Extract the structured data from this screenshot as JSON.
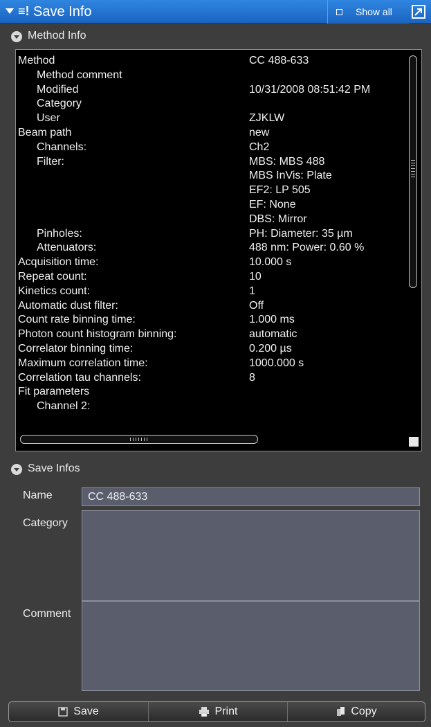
{
  "titlebar": {
    "title": "Save Info",
    "show_all_label": "Show all",
    "icons": [
      "collapse-arrow-icon",
      "list-icon",
      "checkbox-icon",
      "undock-icon"
    ]
  },
  "method_info": {
    "header": "Method Info",
    "rows": [
      {
        "key": "Method",
        "value": "CC 488-633",
        "indent": 0
      },
      {
        "key": "Method comment",
        "value": "",
        "indent": 1
      },
      {
        "key": "Modified",
        "value": "10/31/2008 08:51:42 PM",
        "indent": 1
      },
      {
        "key": "Category",
        "value": "",
        "indent": 1
      },
      {
        "key": "User",
        "value": "ZJKLW",
        "indent": 1
      },
      {
        "key": "Beam path",
        "value": "new",
        "indent": 0
      },
      {
        "key": "Channels:",
        "value": "Ch2",
        "indent": 1
      },
      {
        "key": "Filter:",
        "value": "MBS:  MBS 488",
        "indent": 1
      },
      {
        "key": "",
        "value": "MBS InVis:  Plate",
        "indent": 1
      },
      {
        "key": "",
        "value": "EF2:  LP 505",
        "indent": 1
      },
      {
        "key": "",
        "value": "EF:  None",
        "indent": 1
      },
      {
        "key": "",
        "value": "DBS:  Mirror",
        "indent": 1
      },
      {
        "key": "Pinholes:",
        "value": "PH:  Diameter: 35 µm",
        "indent": 1
      },
      {
        "key": "Attenuators:",
        "value": "488 nm:  Power: 0.60 %",
        "indent": 1
      },
      {
        "key": "Acquisition time:",
        "value": "10.000 s",
        "indent": 0
      },
      {
        "key": "Repeat count:",
        "value": "10",
        "indent": 0
      },
      {
        "key": "Kinetics count:",
        "value": "1",
        "indent": 0
      },
      {
        "key": "Automatic dust filter:",
        "value": "Off",
        "indent": 0
      },
      {
        "key": "Count rate binning time:",
        "value": "1.000 ms",
        "indent": 0
      },
      {
        "key": "Photon count histogram binning:",
        "value": "automatic",
        "indent": 0
      },
      {
        "key": "Correlator binning time:",
        "value": "0.200 µs",
        "indent": 0
      },
      {
        "key": "Maximum correlation time:",
        "value": "1000.000 s",
        "indent": 0
      },
      {
        "key": "Correlation tau channels:",
        "value": "8",
        "indent": 0
      },
      {
        "key": "Fit parameters",
        "value": "",
        "indent": 0
      },
      {
        "key": "Channel 2:",
        "value": "",
        "indent": 1
      }
    ]
  },
  "save_infos": {
    "header": "Save Infos",
    "name_label": "Name",
    "name_value": "CC 488-633",
    "category_label": "Category",
    "category_value": "",
    "comment_label": "Comment",
    "comment_value": ""
  },
  "buttons": {
    "save": "Save",
    "print": "Print",
    "copy": "Copy"
  }
}
